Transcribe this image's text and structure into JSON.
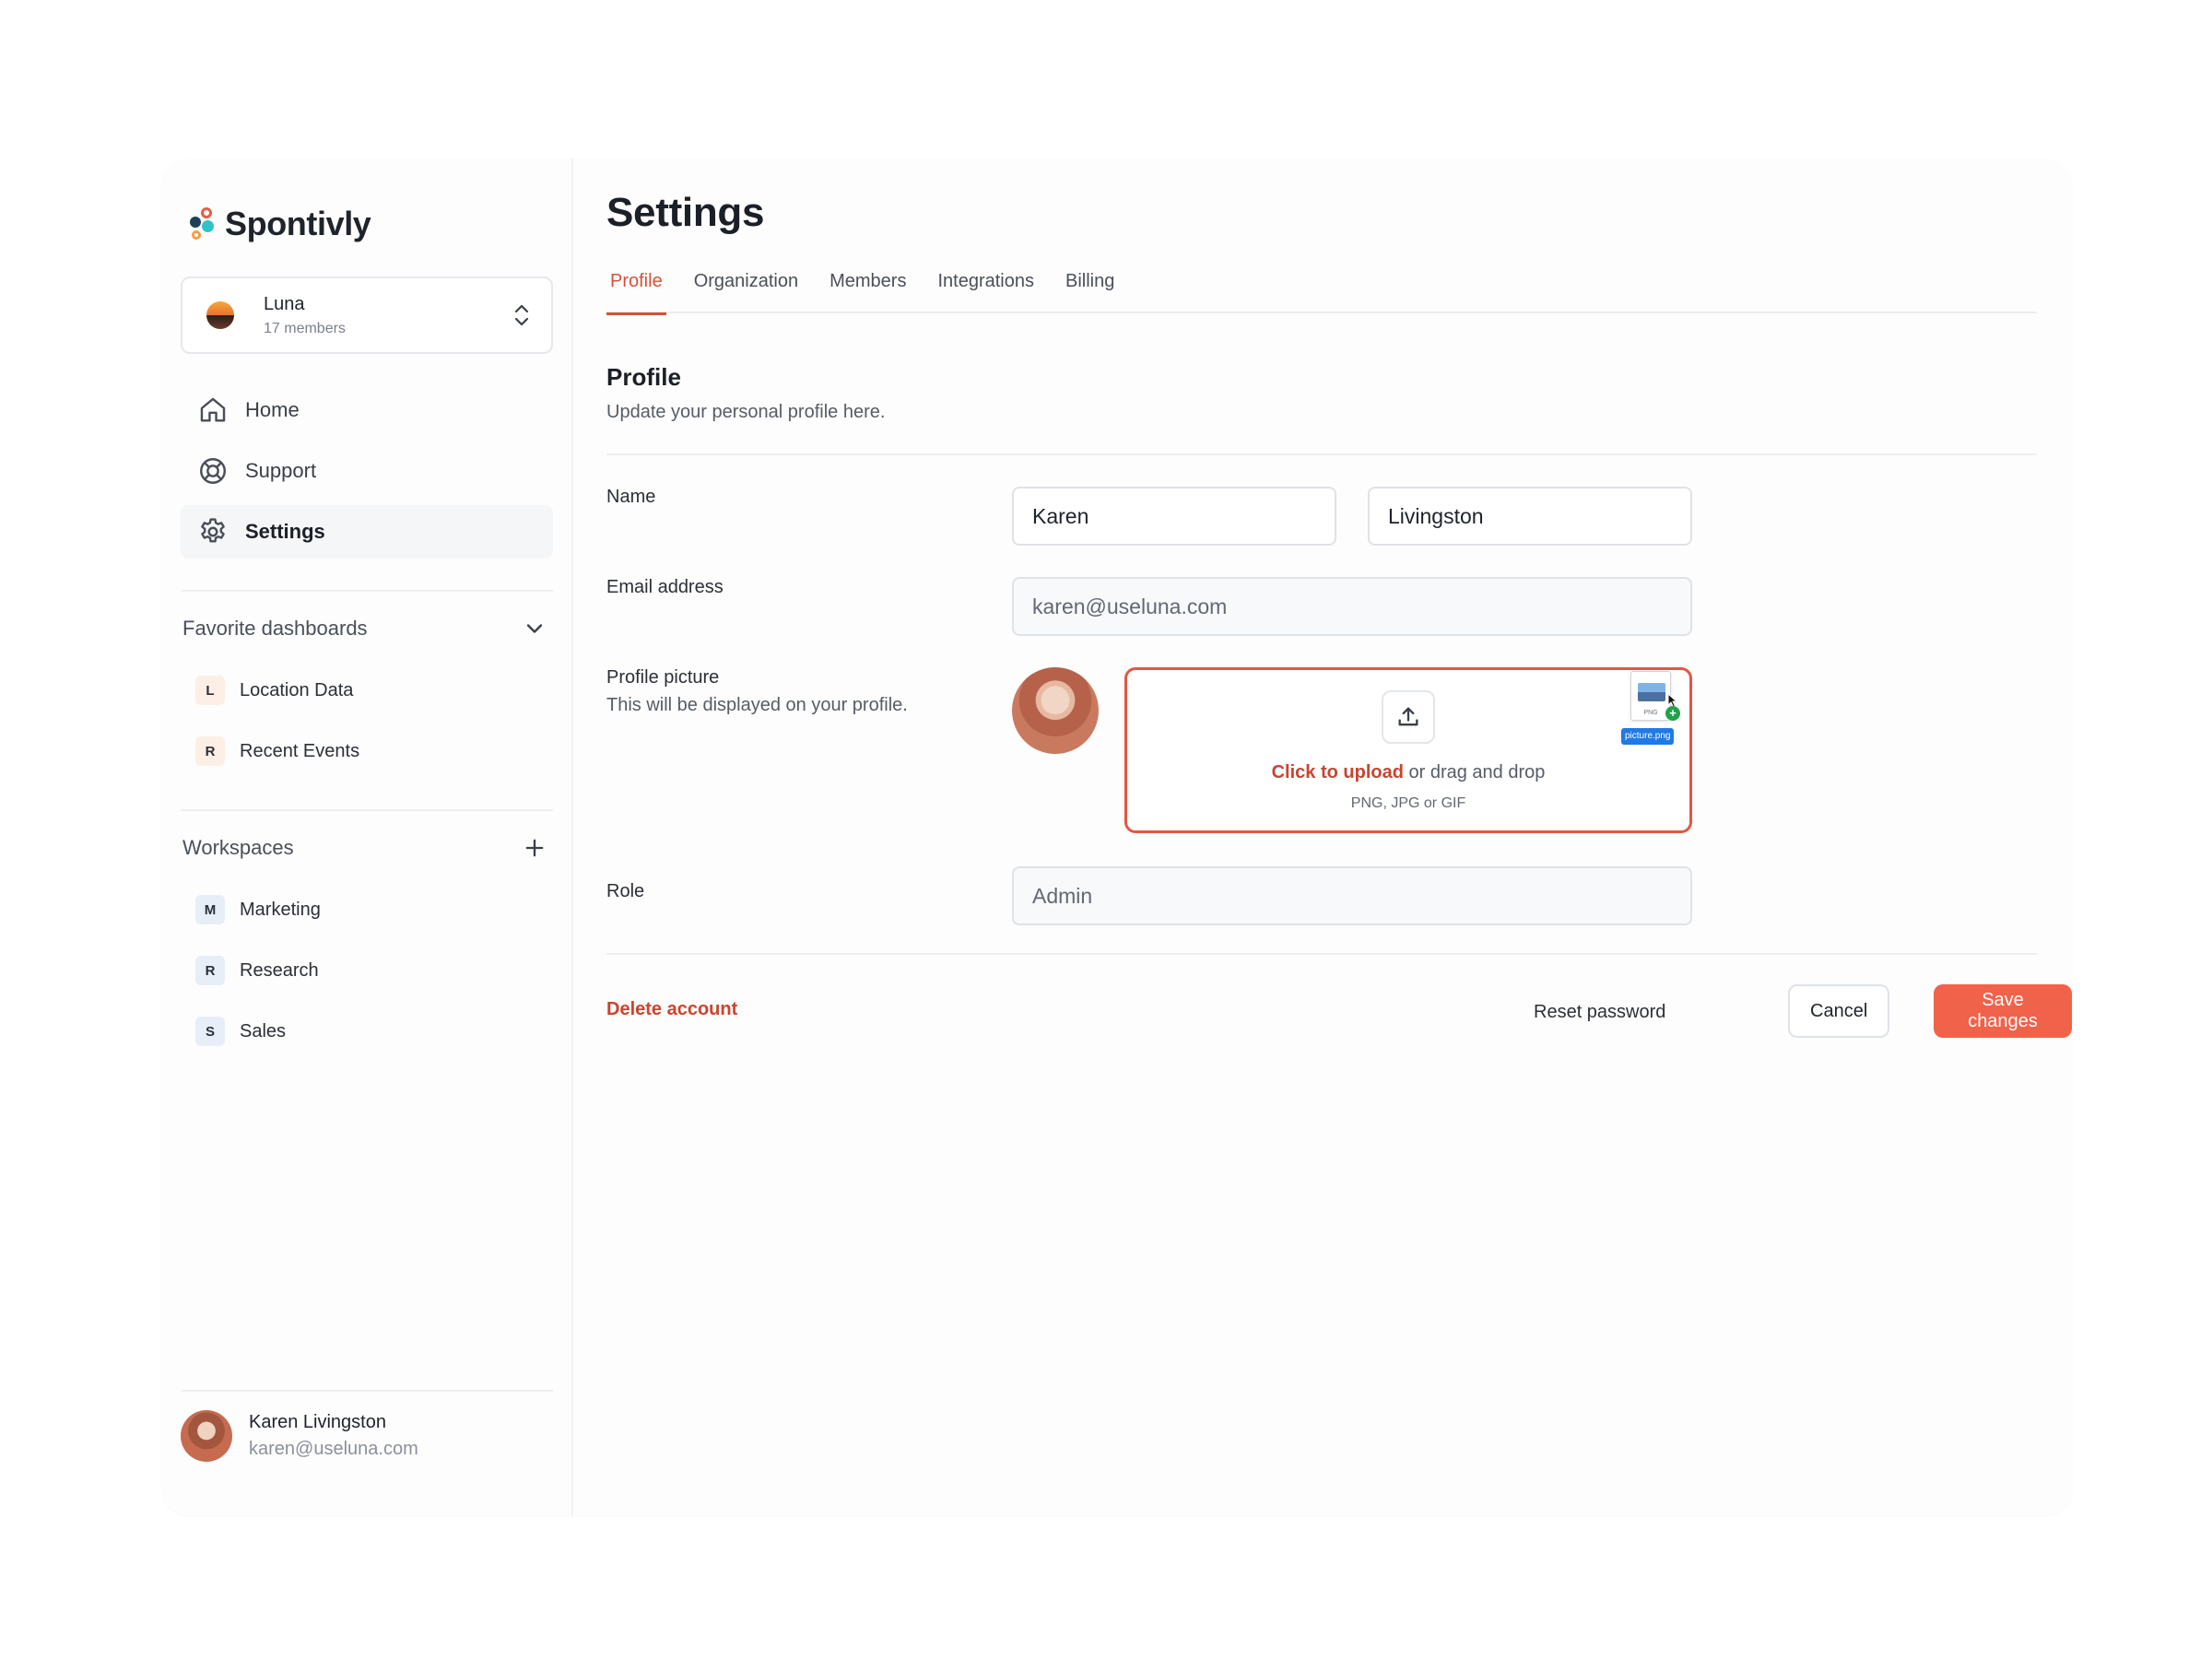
{
  "brand": {
    "name": "Spontivly",
    "logo_colors": [
      "#ea5b46",
      "#1d3f57",
      "#2ec3c7",
      "#f59c45"
    ]
  },
  "workspace_switcher": {
    "name": "Luna",
    "members": "17 members"
  },
  "nav": [
    {
      "label": "Home",
      "icon": "home-icon"
    },
    {
      "label": "Support",
      "icon": "lifebuoy-icon"
    },
    {
      "label": "Settings",
      "icon": "gear-icon",
      "active": true
    }
  ],
  "favorites": {
    "title": "Favorite dashboards",
    "items": [
      {
        "initial": "L",
        "label": "Location Data"
      },
      {
        "initial": "R",
        "label": "Recent Events"
      }
    ]
  },
  "workspaces": {
    "title": "Workspaces",
    "items": [
      {
        "initial": "M",
        "label": "Marketing"
      },
      {
        "initial": "R",
        "label": "Research"
      },
      {
        "initial": "S",
        "label": "Sales"
      }
    ]
  },
  "user": {
    "name": "Karen Livingston",
    "email": "karen@useluna.com"
  },
  "page": {
    "title": "Settings",
    "tabs": [
      "Profile",
      "Organization",
      "Members",
      "Integrations",
      "Billing"
    ],
    "active_tab": "Profile"
  },
  "profile": {
    "title": "Profile",
    "subtitle": "Update your personal profile here.",
    "name_label": "Name",
    "first_name": "Karen",
    "last_name": "Livingston",
    "email_label": "Email address",
    "email_value": "karen@useluna.com",
    "picture_label": "Profile picture",
    "picture_help": "This will be displayed on your profile.",
    "upload_cta": "Click to upload",
    "upload_rest": "or drag and drop",
    "upload_formats": "PNG, JPG or GIF",
    "drag_file_ext": "PNG",
    "drag_file_name": "picture.png",
    "role_label": "Role",
    "role_value": "Admin"
  },
  "actions": {
    "delete": "Delete account",
    "reset": "Reset password",
    "cancel": "Cancel",
    "save": "Save changes"
  },
  "colors": {
    "accent": "#f1624a",
    "accent_text": "#c8452f"
  }
}
